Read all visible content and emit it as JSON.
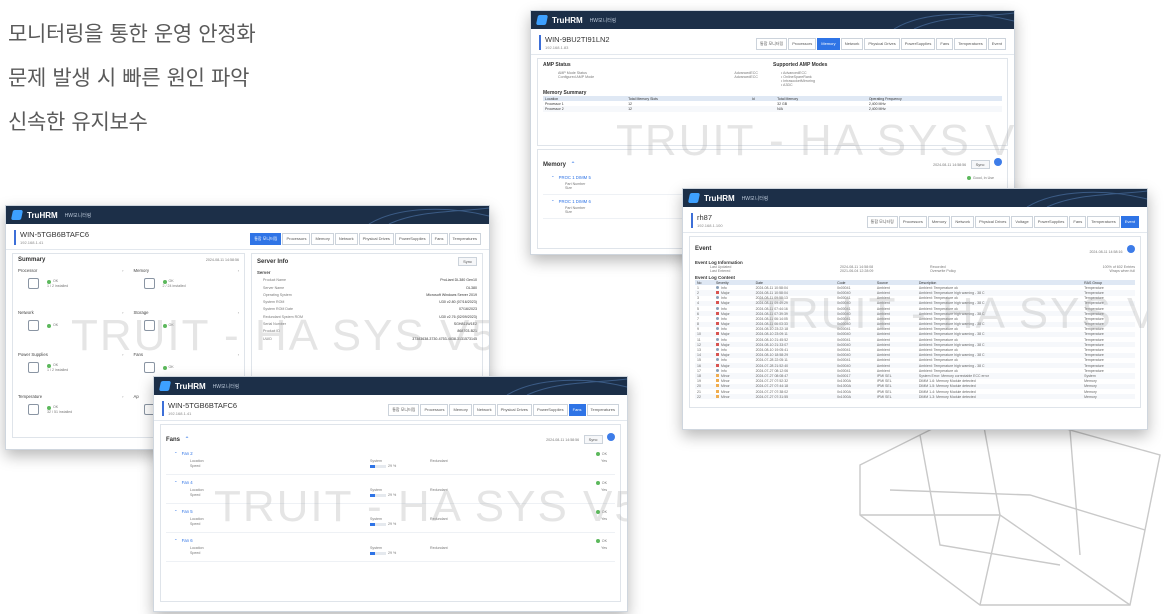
{
  "taglines": [
    "모니터링을 통한 운영 안정화",
    "문제 발생 시 빠른 원인 파악",
    "신속한 유지보수"
  ],
  "app": {
    "brand": "TruHRM",
    "subtitle": "HW모니터링"
  },
  "watermark": "TRUIT - HA SYS V5",
  "memory_window": {
    "host": "WIN-9BU2TI91LN2",
    "ip": "192.168.1.83",
    "tabs": [
      "통합 모니터링",
      "Processors",
      "Memory",
      "Network",
      "Physical Drives",
      "PowerSupplies",
      "Fans",
      "Temperatures",
      "Event"
    ],
    "active_tab": 2,
    "amp_status_title": "AMP Status",
    "amp_rows": [
      [
        "AMP Mode Status",
        "AdvancedECC"
      ],
      [
        "Configured AMP Mode",
        "AdvancedECC"
      ]
    ],
    "supported_title": "Supported AMP Modes",
    "supported": [
      "• AdvancedECC",
      "• OnlineSpareRank",
      "• IntrasocketMirroring",
      "• A3DC"
    ],
    "summary_title": "Memory Summary",
    "summary_headers": [
      "Location",
      "Total Memory Slots",
      "Id",
      "Total Memory",
      "Operating Frequency"
    ],
    "summary_rows": [
      [
        "Processor 1",
        "12",
        "",
        "32 GB",
        "2,400 MHz"
      ],
      [
        "Processor 2",
        "12",
        "",
        "N/A",
        "2,400 MHz"
      ]
    ],
    "memory_title": "Memory",
    "timestamp": "2024-08-11 14:58:56",
    "sync_label": "Sync",
    "dimms": [
      {
        "name": "PROC 1 DIMM 5",
        "status": "Good, In Use",
        "part_label": "Part Number",
        "size_label": "Size"
      },
      {
        "name": "PROC 1 DIMM 6",
        "part_label": "Part Number",
        "size_label": "Size"
      }
    ]
  },
  "event_window": {
    "host": "rh87",
    "ip": "192.168.1.100",
    "tabs": [
      "통합 모니터링",
      "Processors",
      "Memory",
      "Network",
      "Physical Drives",
      "Voltage",
      "PowerSupplies",
      "Fans",
      "Temperatures",
      "Event"
    ],
    "active_tab": 9,
    "title": "Event",
    "timestamp": "2024-08-11 14:58:16",
    "log_info_title": "Event Log Information",
    "log_info": [
      [
        "Last Updated",
        "2024-08-11 14:58:08",
        "Recorded",
        "100% of 602 Entries"
      ],
      [
        "Last Entered",
        "2021-06-04 12:28:09",
        "Overwrite Policy",
        "Wraps when full"
      ]
    ],
    "log_content_title": "Event Log Content",
    "log_headers": [
      "No",
      "Severity",
      "Date",
      "Code",
      "Source",
      "Description",
      "RAS Group"
    ],
    "log_rows": [
      [
        "1",
        "Info",
        "2024-08-11 10:58:04",
        "0x00041",
        "Ambient",
        "Ambient: Temperature ok",
        "Temperature"
      ],
      [
        "2",
        "Major",
        "2024-08-11 10:58:04",
        "0x00040",
        "Ambient",
        "Ambient: Temperature high warning - 38 C",
        "Temperature"
      ],
      [
        "3",
        "Info",
        "2024-08-11 09:58:13",
        "0x00041",
        "Ambient",
        "Ambient: Temperature ok",
        "Temperature"
      ],
      [
        "4",
        "Major",
        "2024-08-11 09:49:29",
        "0x00040",
        "Ambient",
        "Ambient: Temperature high warning - 38 C",
        "Temperature"
      ],
      [
        "5",
        "Info",
        "2024-08-11 07:44:16",
        "0x00041",
        "Ambient",
        "Ambient: Temperature ok",
        "Temperature"
      ],
      [
        "6",
        "Major",
        "2024-08-11 07:39:39",
        "0x00040",
        "Ambient",
        "Ambient: Temperature high warning - 38 C",
        "Temperature"
      ],
      [
        "7",
        "Info",
        "2024-08-11 06:14:05",
        "0x00041",
        "Ambient",
        "Ambient: Temperature ok",
        "Temperature"
      ],
      [
        "8",
        "Major",
        "2024-08-11 06:03:33",
        "0x00040",
        "Ambient",
        "Ambient: Temperature high warning - 38 C",
        "Temperature"
      ],
      [
        "9",
        "Info",
        "2024-08-10 23:22:18",
        "0x00041",
        "Ambient",
        "Ambient: Temperature ok",
        "Temperature"
      ],
      [
        "10",
        "Major",
        "2024-08-10 23:09:11",
        "0x00040",
        "Ambient",
        "Ambient: Temperature high warning - 38 C",
        "Temperature"
      ],
      [
        "11",
        "Info",
        "2024-08-10 21:45:52",
        "0x00041",
        "Ambient",
        "Ambient: Temperature ok",
        "Temperature"
      ],
      [
        "12",
        "Major",
        "2024-08-10 21:33:07",
        "0x00040",
        "Ambient",
        "Ambient: Temperature high warning - 38 C",
        "Temperature"
      ],
      [
        "13",
        "Info",
        "2024-08-10 19:05:41",
        "0x00041",
        "Ambient",
        "Ambient: Temperature ok",
        "Temperature"
      ],
      [
        "14",
        "Major",
        "2024-08-10 18:58:29",
        "0x00040",
        "Ambient",
        "Ambient: Temperature high warning - 38 C",
        "Temperature"
      ],
      [
        "15",
        "Info",
        "2024-07-28 22:05:11",
        "0x00041",
        "Ambient",
        "Ambient: Temperature ok",
        "Temperature"
      ],
      [
        "16",
        "Major",
        "2024-07-28 21:52:40",
        "0x00040",
        "Ambient",
        "Ambient: Temperature high warning - 38 C",
        "Temperature"
      ],
      [
        "17",
        "Info",
        "2024-07-27 08:12:06",
        "0x00041",
        "Ambient",
        "Ambient: Temperature ok",
        "Temperature"
      ],
      [
        "18",
        "Minor",
        "2024-07-27 08:08:47",
        "0x00017",
        "IPMI SEL",
        "System Error: Memory correctable ECC error",
        "System"
      ],
      [
        "19",
        "Minor",
        "2024-07-27 07:52:32",
        "0x1000A",
        "IPMI SEL",
        "DIMM 1-6: Memory Module detected",
        "Memory"
      ],
      [
        "20",
        "Minor",
        "2024-07-27 07:44:18",
        "0x1000A",
        "IPMI SEL",
        "DIMM 1-5: Memory Module detected",
        "Memory"
      ],
      [
        "21",
        "Minor",
        "2024-07-27 07:38:02",
        "0x1000A",
        "IPMI SEL",
        "DIMM 1-4: Memory Module detected",
        "Memory"
      ],
      [
        "22",
        "Minor",
        "2024-07-27 07:31:55",
        "0x1000A",
        "IPMI SEL",
        "DIMM 1-3: Memory Module detected",
        "Memory"
      ]
    ]
  },
  "summary_window": {
    "host": "WIN-5TGB6BTAFC6",
    "ip": "192.168.1.41",
    "tabs": [
      "통합 모니터링",
      "Processors",
      "Memory",
      "Network",
      "Physical Drives",
      "PowerSupplies",
      "Fans",
      "Temperatures"
    ],
    "active_tab": 0,
    "summary_title": "Summary",
    "timestamp": "2024-08-11 14:58:56",
    "cards": [
      {
        "name": "Processor",
        "status": "OK",
        "detail": "1 / 2 installed"
      },
      {
        "name": "Memory",
        "status": "OK",
        "detail": "2 / 24 installed"
      },
      {
        "name": "Network",
        "status": "OK",
        "detail": ""
      },
      {
        "name": "Storage",
        "status": "OK",
        "detail": ""
      },
      {
        "name": "Power Supplies",
        "status": "OK",
        "detail": "1 / 2 installed"
      },
      {
        "name": "Fans",
        "status": "OK",
        "detail": ""
      },
      {
        "name": "Temperature",
        "status": "OK",
        "detail": "32 / 51 installed"
      },
      {
        "name": "Ap",
        "status": "",
        "detail": ""
      }
    ],
    "server_info_title": "Server Info",
    "server_title": "Server",
    "server_rows": [
      [
        "Product Name",
        "ProLiant DL380 Gen10"
      ],
      [
        "Server Name",
        "DL380"
      ],
      [
        "Operating System",
        "Microsoft Windows Server 2019"
      ],
      [
        "System ROM",
        "U30 v2.80 (07/16/2023)"
      ],
      [
        "System ROM Date",
        "07/16/2023"
      ],
      [
        "Redundant System ROM",
        "U30 v2.76 (02/09/2023)"
      ],
      [
        "Serial Number",
        "SGH811W1E2"
      ],
      [
        "Product ID",
        "868703-B21"
      ],
      [
        "UUID",
        "37383638-3730-4753-4838-3131573145"
      ]
    ],
    "sync_label": "Sync"
  },
  "fans_window": {
    "host": "WIN-5TGB6BTAFC6",
    "ip": "192.168.1.41",
    "tabs": [
      "통합 모니터링",
      "Processors",
      "Memory",
      "Network",
      "Physical Drives",
      "PowerSupplies",
      "Fans",
      "Temperatures"
    ],
    "active_tab": 6,
    "title": "Fans",
    "timestamp": "2024-08-11 14:58:56",
    "sync_label": "Sync",
    "fans": [
      {
        "name": "Fan 2",
        "location_label": "Location",
        "location": "System",
        "speed_label": "Speed",
        "speed": "29 %",
        "redundant_label": "Redundant",
        "redundant": "Yes",
        "status": "OK",
        "speed_value": 0.29
      },
      {
        "name": "Fan 4",
        "location_label": "Location",
        "location": "System",
        "speed_label": "Speed",
        "speed": "29 %",
        "redundant_label": "Redundant",
        "redundant": "Yes",
        "status": "OK",
        "speed_value": 0.29
      },
      {
        "name": "Fan 5",
        "location_label": "Location",
        "location": "System",
        "speed_label": "Speed",
        "speed": "29 %",
        "redundant_label": "Redundant",
        "redundant": "Yes",
        "status": "OK",
        "speed_value": 0.29
      },
      {
        "name": "Fan 6",
        "location_label": "Location",
        "location": "System",
        "speed_label": "Speed",
        "speed": "29 %",
        "redundant_label": "Redundant",
        "redundant": "Yes",
        "status": "OK",
        "speed_value": 0.29
      }
    ]
  },
  "colors": {
    "accent": "#2f74e6",
    "titlebar": "#1c2f48",
    "ok": "#5cb85c",
    "major": "#d9534f",
    "minor": "#f0ad4e"
  }
}
